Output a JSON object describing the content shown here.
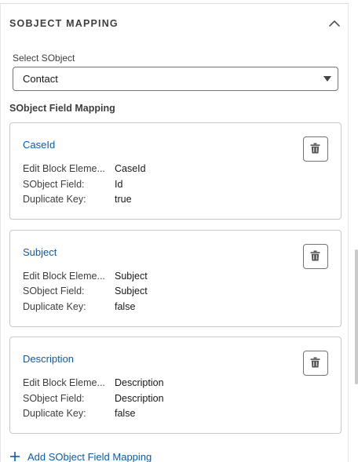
{
  "section": {
    "title": "SOBJECT MAPPING",
    "collapse_icon": "chevron-up-icon"
  },
  "sobject_select": {
    "label": "Select SObject",
    "value": "Contact"
  },
  "field_mapping": {
    "heading": "SObject Field Mapping",
    "row_labels": {
      "edit_block_element": "Edit Block Eleme...",
      "sobject_field": "SObject Field:",
      "duplicate_key": "Duplicate Key:"
    },
    "cards": [
      {
        "title": "CaseId",
        "edit_block_element": "CaseId",
        "sobject_field": "Id",
        "duplicate_key": "true"
      },
      {
        "title": "Subject",
        "edit_block_element": "Subject",
        "sobject_field": "Subject",
        "duplicate_key": "false"
      },
      {
        "title": "Description",
        "edit_block_element": "Description",
        "sobject_field": "Description",
        "duplicate_key": "false"
      }
    ]
  },
  "add_link": {
    "label": "Add SObject Field Mapping",
    "icon": "plus-icon"
  },
  "colors": {
    "link": "#0b5cab",
    "border": "#c9c9c9",
    "text": "#3e3e3c"
  }
}
